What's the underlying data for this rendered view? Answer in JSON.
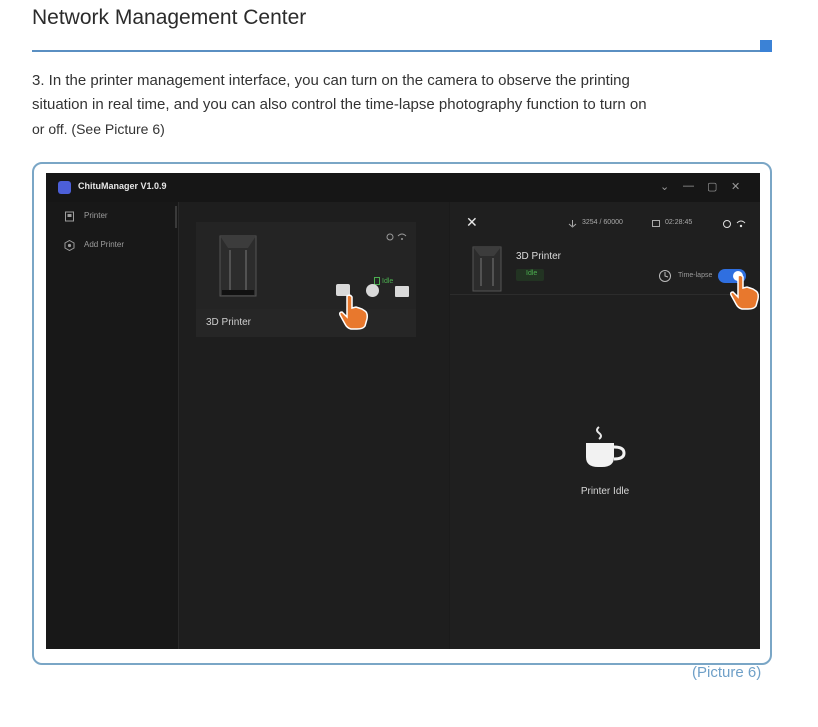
{
  "page": {
    "title": "Network Management Center",
    "paragraph_line1": "3. In the printer management interface, you can turn on the camera to observe the printing",
    "paragraph_line2": "situation in real time, and you can also control the time-lapse photography function to turn on",
    "paragraph_line3": "or off. (See Picture 6)",
    "caption": "(Picture 6)"
  },
  "app": {
    "name": "ChituManager V1.0.9",
    "window_controls": [
      "⌄",
      "—",
      "▢",
      "✕"
    ]
  },
  "sidebar": {
    "items": [
      {
        "label": "Printer",
        "icon": "printer-icon"
      },
      {
        "label": "Add Printer",
        "icon": "hexagon-icon"
      }
    ]
  },
  "printer_card": {
    "name": "3D Printer",
    "status": "Idle"
  },
  "detail": {
    "counter": "3254 / 60000",
    "time": "02:28:45",
    "printer_name": "3D Printer",
    "status": "Idle",
    "timelapse_label": "Time-lapse",
    "timelapse_on": true,
    "idle_message": "Printer Idle"
  },
  "colors": {
    "accent": "#2f6fe0",
    "status_green": "#4caf50",
    "pointer_orange": "#e8782d"
  }
}
